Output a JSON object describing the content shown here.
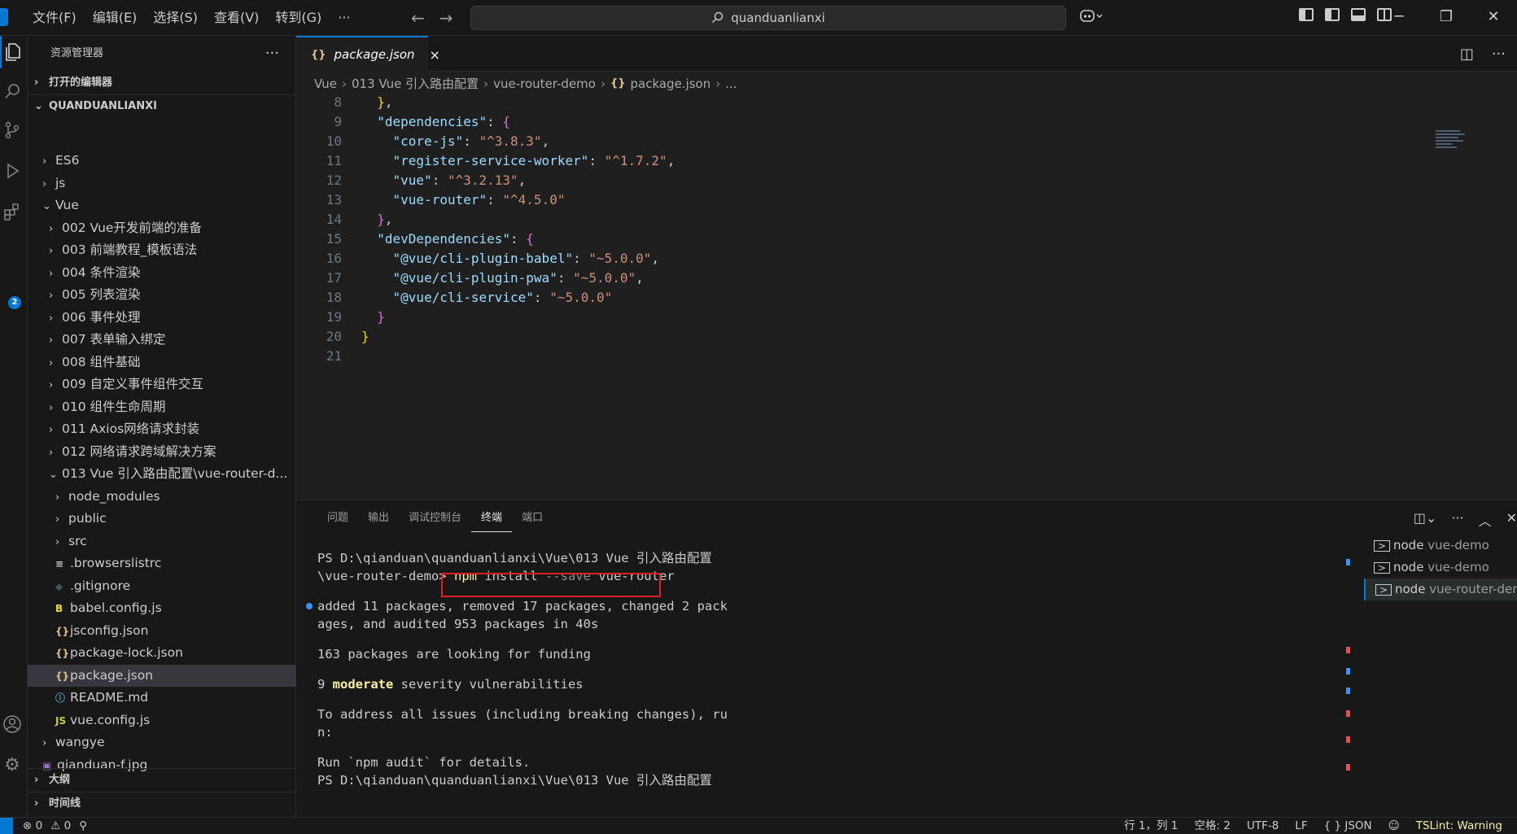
{
  "titlebar": {
    "menus": [
      "文件(F)",
      "编辑(E)",
      "选择(S)",
      "查看(V)",
      "转到(G)",
      "···"
    ],
    "search_text": "quanduanlianxi",
    "nav_back": "←",
    "nav_forward": "→"
  },
  "sidebar": {
    "title": "资源管理器",
    "more": "···",
    "open_editors": "打开的编辑器",
    "workspace": "QUANDUANLIANXI",
    "tree": [
      {
        "label": "ES6",
        "chev": "›",
        "icon": "",
        "indent": 1
      },
      {
        "label": "js",
        "chev": "›",
        "icon": "",
        "indent": 1
      },
      {
        "label": "Vue",
        "chev": "⌄",
        "icon": "",
        "indent": 1
      },
      {
        "label": "002 Vue开发前端的准备",
        "chev": "›",
        "icon": "",
        "indent": 2
      },
      {
        "label": "003 前端教程_模板语法",
        "chev": "›",
        "icon": "",
        "indent": 2
      },
      {
        "label": "004 条件渲染",
        "chev": "›",
        "icon": "",
        "indent": 2
      },
      {
        "label": "005 列表渲染",
        "chev": "›",
        "icon": "",
        "indent": 2
      },
      {
        "label": "006 事件处理",
        "chev": "›",
        "icon": "",
        "indent": 2
      },
      {
        "label": "007 表单输入绑定",
        "chev": "›",
        "icon": "",
        "indent": 2
      },
      {
        "label": "008 组件基础",
        "chev": "›",
        "icon": "",
        "indent": 2
      },
      {
        "label": "009 自定义事件组件交互",
        "chev": "›",
        "icon": "",
        "indent": 2
      },
      {
        "label": "010 组件生命周期",
        "chev": "›",
        "icon": "",
        "indent": 2
      },
      {
        "label": "011 Axios网络请求封装",
        "chev": "›",
        "icon": "",
        "indent": 2
      },
      {
        "label": "012 网络请求跨域解决方案",
        "chev": "›",
        "icon": "",
        "indent": 2
      },
      {
        "label": "013 Vue 引入路由配置\\vue-router-d...",
        "chev": "⌄",
        "icon": "",
        "indent": 2
      },
      {
        "label": "node_modules",
        "chev": "›",
        "icon": "",
        "indent": 3
      },
      {
        "label": "public",
        "chev": "›",
        "icon": "",
        "indent": 3
      },
      {
        "label": "src",
        "chev": "›",
        "icon": "",
        "indent": 3
      },
      {
        "label": ".browserslistrc",
        "chev": "",
        "icon": "≡",
        "icolor": "#cccccc",
        "indent": 3
      },
      {
        "label": ".gitignore",
        "chev": "",
        "icon": "◆",
        "icolor": "#41535b",
        "indent": 3
      },
      {
        "label": "babel.config.js",
        "chev": "",
        "icon": "B",
        "icolor": "#f5de19",
        "indent": 3
      },
      {
        "label": "jsconfig.json",
        "chev": "",
        "icon": "{}",
        "icolor": "#e2c08d",
        "indent": 3
      },
      {
        "label": "package-lock.json",
        "chev": "",
        "icon": "{}",
        "icolor": "#e2c08d",
        "indent": 3
      },
      {
        "label": "package.json",
        "chev": "",
        "icon": "{}",
        "icolor": "#e2c08d",
        "indent": 3,
        "selected": true
      },
      {
        "label": "README.md",
        "chev": "",
        "icon": "ⓘ",
        "icolor": "#519aba",
        "indent": 3
      },
      {
        "label": "vue.config.js",
        "chev": "",
        "icon": "JS",
        "icolor": "#cbcb41",
        "indent": 3
      },
      {
        "label": "wangye",
        "chev": "›",
        "icon": "",
        "indent": 1
      },
      {
        "label": "qianduan-f.jpg",
        "chev": "",
        "icon": "▣",
        "icolor": "#a074c4",
        "indent": 1
      }
    ],
    "outline": "大纲",
    "timeline": "时间线"
  },
  "editor": {
    "tab_label": "package.json",
    "tab_icon": "{}",
    "tab_close": "×",
    "breadcrumb": [
      "Vue",
      "013 Vue 引入路由配置",
      "vue-router-demo",
      "package.json",
      "..."
    ],
    "code_lines": [
      {
        "n": "8",
        "html": "  <span class='b2'>}</span><span class='p'>,</span>"
      },
      {
        "n": "9",
        "html": "  <span class='k'>\"dependencies\"</span><span class='p'>: </span><span class='b1'>{</span>"
      },
      {
        "n": "10",
        "html": "    <span class='k'>\"core-js\"</span><span class='p'>: </span><span class='s'>\"^3.8.3\"</span><span class='p'>,</span>"
      },
      {
        "n": "11",
        "html": "    <span class='k'>\"register-service-worker\"</span><span class='p'>: </span><span class='s'>\"^1.7.2\"</span><span class='p'>,</span>"
      },
      {
        "n": "12",
        "html": "    <span class='k'>\"vue\"</span><span class='p'>: </span><span class='s'>\"^3.2.13\"</span><span class='p'>,</span>"
      },
      {
        "n": "13",
        "html": "    <span class='k'>\"vue-router\"</span><span class='p'>: </span><span class='s'>\"^4.5.0\"</span>"
      },
      {
        "n": "14",
        "html": "  <span class='b1'>}</span><span class='p'>,</span>"
      },
      {
        "n": "15",
        "html": "  <span class='k'>\"devDependencies\"</span><span class='p'>: </span><span class='b1'>{</span>"
      },
      {
        "n": "16",
        "html": "    <span class='k'>\"@vue/cli-plugin-babel\"</span><span class='p'>: </span><span class='s'>\"~5.0.0\"</span><span class='p'>,</span>"
      },
      {
        "n": "17",
        "html": "    <span class='k'>\"@vue/cli-plugin-pwa\"</span><span class='p'>: </span><span class='s'>\"~5.0.0\"</span><span class='p'>,</span>"
      },
      {
        "n": "18",
        "html": "    <span class='k'>\"@vue/cli-service\"</span><span class='p'>: </span><span class='s'>\"~5.0.0\"</span>"
      },
      {
        "n": "19",
        "html": "  <span class='b1'>}</span>"
      },
      {
        "n": "20",
        "html": "<span class='b2'>}</span>"
      },
      {
        "n": "21",
        "html": ""
      }
    ]
  },
  "panel": {
    "tabs": [
      "问题",
      "输出",
      "调试控制台",
      "终端",
      "端口"
    ],
    "active_tab": 3,
    "terminal": {
      "line1": "PS D:\\qianduan\\quanduanlianxi\\Vue\\013 Vue 引入路由配置",
      "line2_prefix": "\\vue-router-demo> ",
      "cmd_npm": "npm",
      "cmd_install": " install ",
      "cmd_flag": "--save",
      "cmd_pkg": " vue-router",
      "line3": "added 11 packages, removed 17 packages, changed 2 pack",
      "line4": "ages, and audited 953 packages in 40s",
      "line5": "163 packages are looking for funding",
      "line6_num": "9 ",
      "line6_word": "moderate",
      "line6_rest": " severity vulnerabilities",
      "line7": "To address all issues (including breaking changes), ru",
      "line8": "n:",
      "line9": "Run `npm audit` for details.",
      "line10": "PS D:\\qianduan\\quanduanlianxi\\Vue\\013 Vue 引入路由配置"
    },
    "terminals": [
      {
        "name": "node",
        "title": "vue-demo"
      },
      {
        "name": "node",
        "title": "vue-demo"
      },
      {
        "name": "node",
        "title": "vue-router-demo"
      }
    ]
  },
  "statusbar": {
    "errors": "⊗ 0",
    "warnings": "⚠ 0",
    "position": "行 1，列 1",
    "spaces": "空格: 2",
    "encoding": "UTF-8",
    "eol": "LF",
    "language": "{ } JSON",
    "tslint": "TSLint: Warning"
  },
  "colors": {
    "accent": "#0078d4",
    "highlight_box": "#e02020"
  }
}
